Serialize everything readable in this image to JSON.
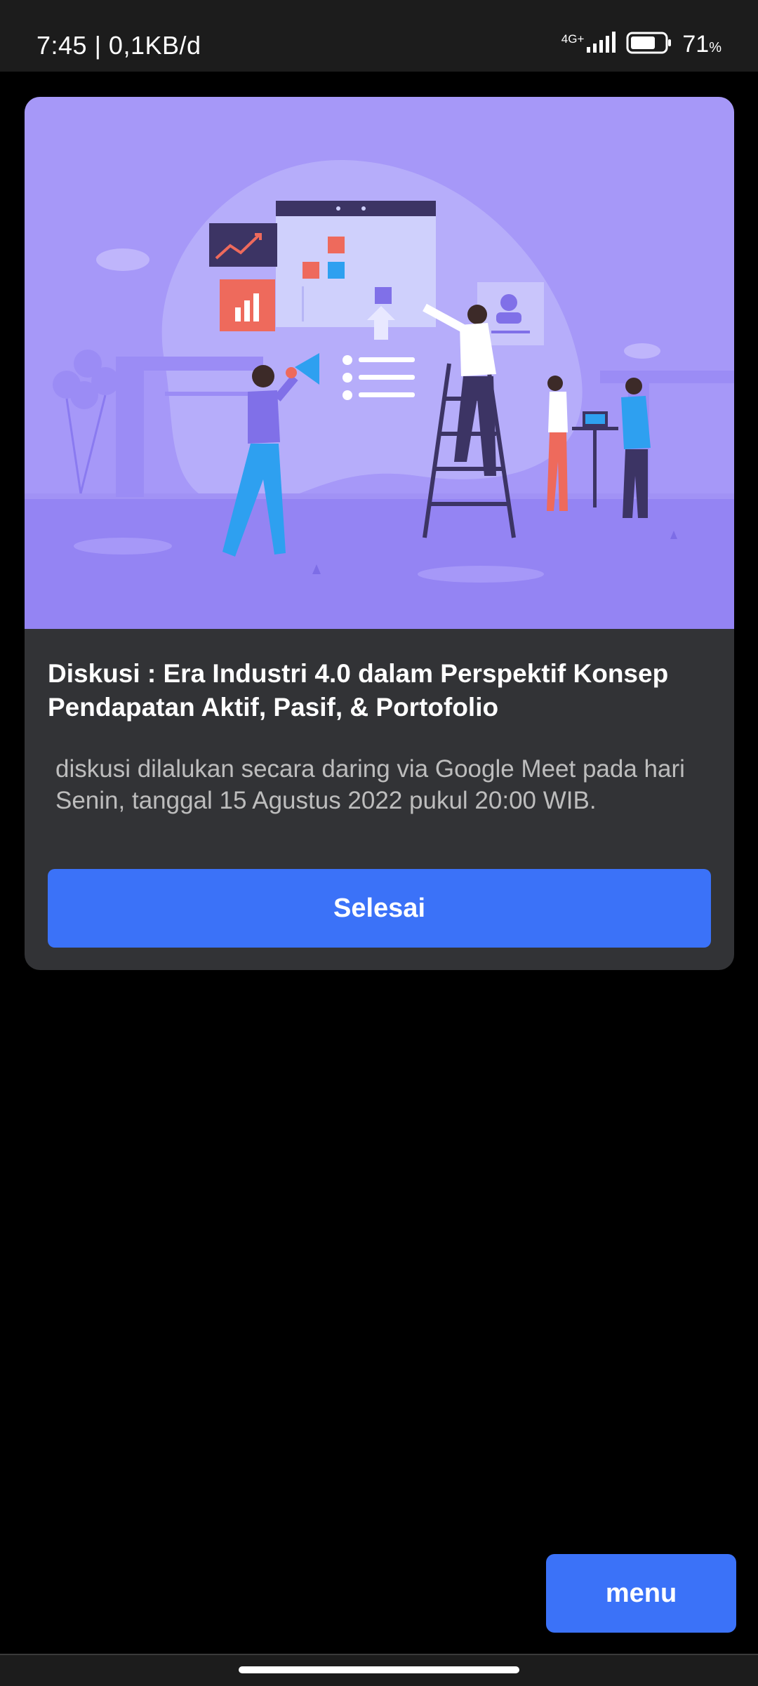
{
  "status_bar": {
    "time": "7:45 | 0,1KB/d",
    "network": "4G+",
    "battery_level": "71",
    "battery_unit": "%"
  },
  "dialog": {
    "title": "Diskusi : Era Industri 4.0 dalam Perspektif Konsep Pendapatan Aktif, Pasif, & Portofolio",
    "description": "diskusi dilalukan secara daring via Google Meet pada hari Senin, tanggal 15 Agustus 2022 pukul 20:00 WIB.",
    "done_label": "Selesai"
  },
  "menu_label": "menu",
  "colors": {
    "accent": "#3b72f8",
    "card": "#323336",
    "hero_bg": "#a698f8"
  },
  "icons": {
    "signal": "signal-bars-icon",
    "battery": "battery-icon",
    "hero": "team-planning-illustration"
  }
}
